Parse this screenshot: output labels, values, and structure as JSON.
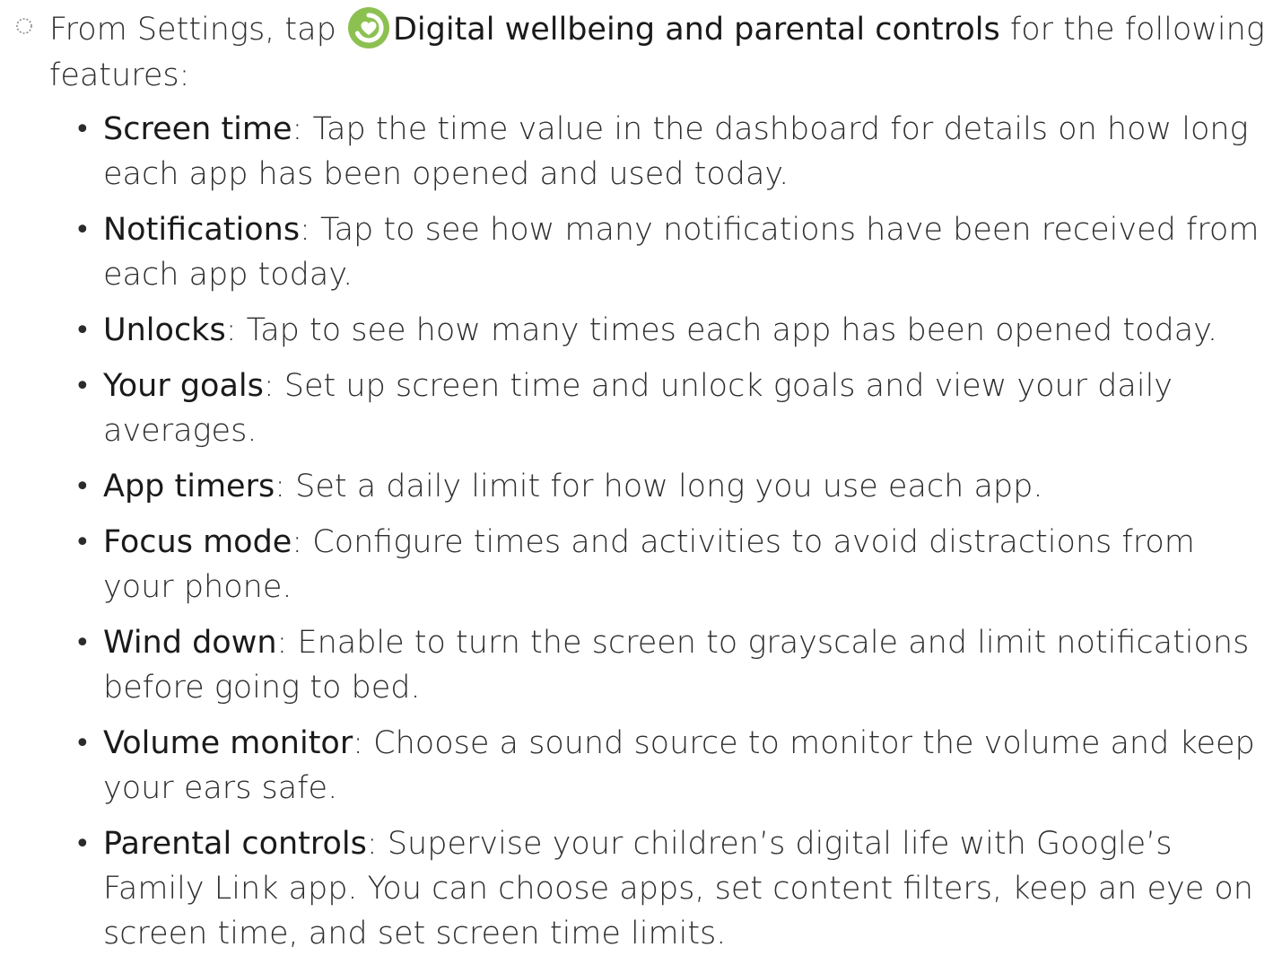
{
  "intro": {
    "prefix": "From Settings, tap",
    "setting_name": "Digital wellbeing and parental controls",
    "suffix": " for the following features:",
    "icon": "digital-wellbeing-icon",
    "icon_color": "#8cc152"
  },
  "features": [
    {
      "term": "Screen time",
      "desc": ": Tap the time value in the dashboard for details on how long each app has been opened and used today."
    },
    {
      "term": "Notifications",
      "desc": ": Tap to see how many notifications have been received from each app today."
    },
    {
      "term": "Unlocks",
      "desc": ": Tap to see how many times each app has been opened today."
    },
    {
      "term": "Your goals",
      "desc": ": Set up screen time and unlock goals and view your daily averages."
    },
    {
      "term": "App timers",
      "desc": ": Set a daily limit for how long you use each app."
    },
    {
      "term": "Focus mode",
      "desc": ": Configure times and activities to avoid distractions from your phone."
    },
    {
      "term": "Wind down",
      "desc": ": Enable to turn the screen to grayscale and limit notifications before going to bed."
    },
    {
      "term": "Volume monitor",
      "desc": ": Choose a sound source to monitor the volume and keep your ears safe."
    },
    {
      "term": "Parental controls",
      "desc": ": Supervise your children’s digital life with Google’s Family Link app. You can choose apps, set content filters, keep an eye on screen time, and set screen time limits."
    }
  ],
  "bullet_char": "•"
}
